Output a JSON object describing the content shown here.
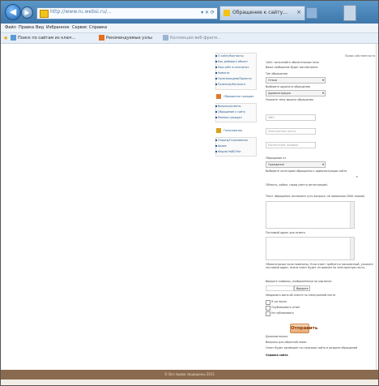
{
  "browser": {
    "address_url": "http://www.ru.websi.ru/...",
    "address_buttons": "▾ ✕ ⟳",
    "tab_label": "Обращение к сайту...",
    "tab_close": "×"
  },
  "menu": {
    "items": [
      "Файл",
      "Правка",
      "Вид",
      "Избранное",
      "Сервис",
      "Справка"
    ]
  },
  "favorites": {
    "items": [
      "Поиск по сайтам из ключ...",
      "Рекомендуемые узлы",
      "Коллекция веб-фрагм..."
    ]
  },
  "sidebar": {
    "top_items": [
      "О сайте/Контакты",
      "Как добавить объект",
      "Наш сайт в каталогах",
      "Новости",
      "Организациям/Проекты",
      "Полезное/Каталоги"
    ],
    "group1_title": "Обращения граждан",
    "group1_items": [
      "Вопросы/ответы",
      "Обращение к сайту",
      "Мнения граждан"
    ],
    "group2_title": "Голосования",
    "group2_items": [
      "Опросы/Голосования",
      "Архив",
      "Форум/ЧаВО/Чат"
    ]
  },
  "form": {
    "header_right": "Права собственности",
    "intro_line1": "Сайт: заполняйте обязательные поля",
    "intro_line2": "Ваше сообщение будет рассмотрено",
    "type_label": "Тип обращения",
    "type_select": "Отзыв",
    "recipient_label": "Выберите адресата обращения",
    "recipient_select": "Администрация",
    "topic_label": "Укажите тему вашего обращения",
    "name_placeholder": "ФИО",
    "email_placeholder": "Электронная почта",
    "phone_placeholder": "Контактный телефон",
    "gender_label": "Обращение от",
    "gender_select": "Гражданин",
    "category_label": "Выберите категорию обращения к администрации сайта",
    "region_label": "Область, район, город (место регистрации)",
    "message_label": "Текст обращения (изложите суть вопроса, не превышая 2000 знаков)",
    "address_label": "Почтовый адрес для ответа",
    "info_text": "Обязательные поля помечены. Если ответ требуется письменный, укажите почтовый адрес, иначе ответ будет отправлен на электронную почту.",
    "captcha_label": "Введите символы, изображённые на картинке",
    "captcha_value": "Введите",
    "notify_label": "Уведомить меня об ответе по электронной почте",
    "check1": "Я согласен",
    "check2": "Опубликовать ответ",
    "check3": "Не публиковать",
    "submit_label": "Отправить",
    "after_submit1": "Дополнительно",
    "after_submit2": "Вопросы для обратной связи",
    "after_submit3": "Ответ будет размещён на странице сайта в разделе обращений",
    "bottom_bold": "Справка сайта"
  },
  "footer": {
    "text": "© Все права защищены 2011"
  }
}
